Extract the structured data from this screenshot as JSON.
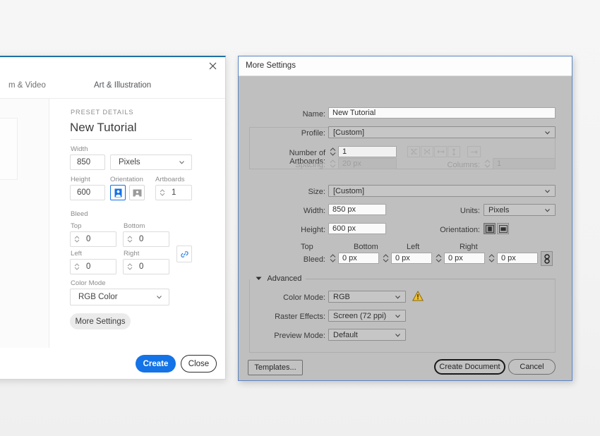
{
  "newdoc": {
    "close_icon": "close-icon",
    "tabs": [
      {
        "label": "m & Video"
      },
      {
        "label": "Art & Illustration"
      }
    ],
    "preset_details_label": "PRESET DETAILS",
    "preset_name": "New Tutorial",
    "width_label": "Width",
    "width_value": "850",
    "units_value": "Pixels",
    "height_label": "Height",
    "height_value": "600",
    "orientation_label": "Orientation",
    "artboards_label": "Artboards",
    "artboards_value": "1",
    "bleed_label": "Bleed",
    "bleed_top_label": "Top",
    "bleed_top_value": "0",
    "bleed_bottom_label": "Bottom",
    "bleed_bottom_value": "0",
    "bleed_left_label": "Left",
    "bleed_left_value": "0",
    "bleed_right_label": "Right",
    "bleed_right_value": "0",
    "colormode_label": "Color Mode",
    "colormode_value": "RGB Color",
    "more_settings_label": "More Settings",
    "create_label": "Create",
    "close_label": "Close",
    "accent_color": "#1473e6"
  },
  "moresettings": {
    "title": "More Settings",
    "name_label": "Name:",
    "name_value": "New Tutorial",
    "profile_label": "Profile:",
    "profile_value": "[Custom]",
    "artboards_label": "Number of Artboards:",
    "artboards_value": "1",
    "arrange_icons": [
      "grid-by-row-icon",
      "grid-by-column-icon",
      "arrange-by-row-icon",
      "arrange-by-column-icon"
    ],
    "arrange_direction_icon": "right-to-left-icon",
    "spacing_label": "Spacing:",
    "spacing_value": "20 px",
    "columns_label": "Columns:",
    "columns_value": "1",
    "size_label": "Size:",
    "size_value": "[Custom]",
    "width_label": "Width:",
    "width_value": "850 px",
    "units_label": "Units:",
    "units_value": "Pixels",
    "height_label": "Height:",
    "height_value": "600 px",
    "orientation_label": "Orientation:",
    "bleed_label": "Bleed:",
    "bleed_top_label": "Top",
    "bleed_top_value": "0 px",
    "bleed_bottom_label": "Bottom",
    "bleed_bottom_value": "0 px",
    "bleed_left_label": "Left",
    "bleed_left_value": "0 px",
    "bleed_right_label": "Right",
    "bleed_right_value": "0 px",
    "bleed_link_icon": "link-chain-icon",
    "advanced_label": "Advanced",
    "colormode_label": "Color Mode:",
    "colormode_value": "RGB",
    "colormode_warning_icon": "warning-triangle-icon",
    "raster_label": "Raster Effects:",
    "raster_value": "Screen (72 ppi)",
    "preview_label": "Preview Mode:",
    "preview_value": "Default",
    "templates_label": "Templates...",
    "create_document_label": "Create Document",
    "cancel_label": "Cancel",
    "warning_color": "#f2c12e",
    "border_color": "#5b86c4"
  }
}
